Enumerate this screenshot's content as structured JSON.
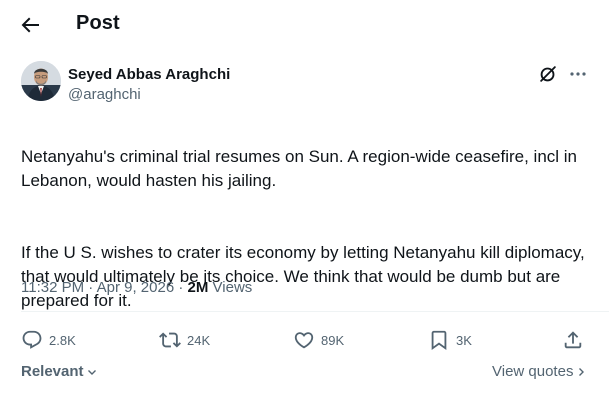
{
  "header": {
    "title": "Post"
  },
  "post": {
    "author_name": "Seyed Abbas Araghchi",
    "author_handle": "@araghchi",
    "paragraphs": [
      "Netanyahu's criminal trial resumes on Sun. A region-wide ceasefire, incl in Lebanon, would hasten his jailing.",
      "If the U S. wishes to crater its economy by letting Netanyahu kill diplomacy, that would ultimately be its choice. We think that would be dumb but are prepared for it."
    ],
    "time": "11:32 PM",
    "date": "Apr 9, 2026",
    "views_count": "2M",
    "views_label": "Views"
  },
  "actions": {
    "replies": "2.8K",
    "reposts": "24K",
    "likes": "89K",
    "bookmarks": "3K"
  },
  "footer": {
    "sort_label": "Relevant",
    "view_quotes_label": "View quotes"
  },
  "colors": {
    "text": "#0f1419",
    "secondary": "#536471",
    "divider": "#eff3f4"
  },
  "icons": [
    "back-arrow-icon",
    "grok-icon",
    "more-icon",
    "reply-icon",
    "repost-icon",
    "like-icon",
    "bookmark-icon",
    "share-icon",
    "chevron-down-icon",
    "chevron-right-icon"
  ]
}
